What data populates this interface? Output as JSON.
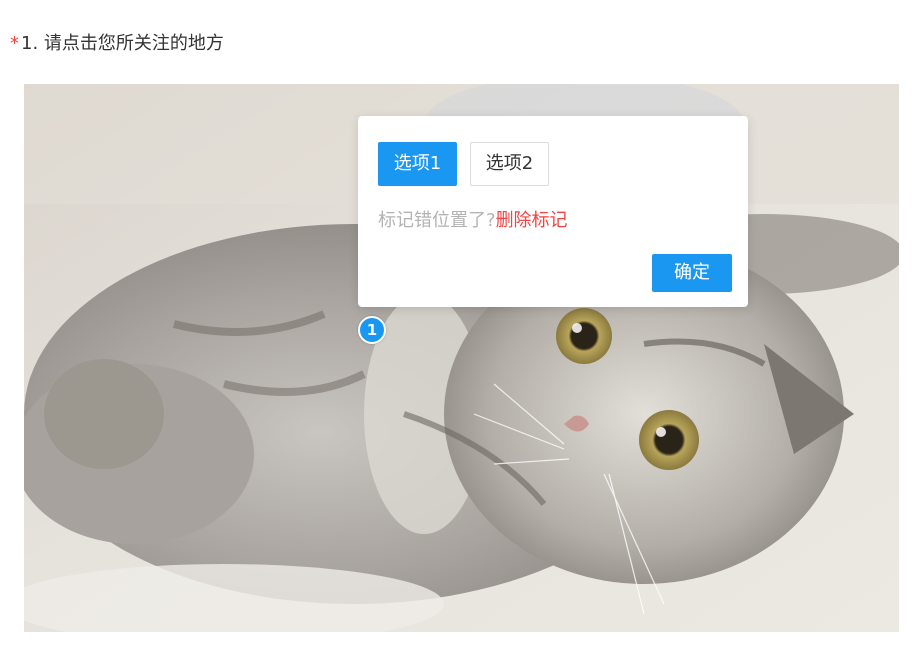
{
  "question": {
    "required_mark": "*",
    "text": "1. 请点击您所关注的地方"
  },
  "image": {
    "subject": "cat-photo"
  },
  "popup": {
    "options": [
      {
        "label": "选项1",
        "selected": true
      },
      {
        "label": "选项2",
        "selected": false
      }
    ],
    "hint_text": "标记错位置了?",
    "delete_label": "删除标记",
    "confirm_label": "确定"
  },
  "marker": {
    "label": "1"
  },
  "colors": {
    "accent": "#1a98f1",
    "danger": "#ef4444",
    "hint": "#b3b3b3",
    "text": "#333333"
  }
}
